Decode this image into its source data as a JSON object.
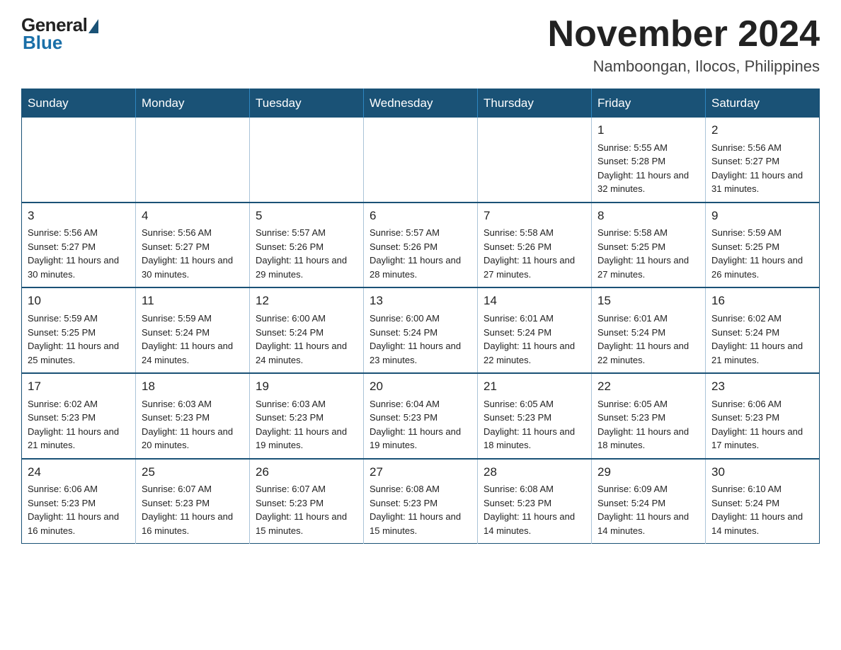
{
  "logo": {
    "general": "General",
    "blue": "Blue"
  },
  "header": {
    "month": "November 2024",
    "location": "Namboongan, Ilocos, Philippines"
  },
  "days_of_week": [
    "Sunday",
    "Monday",
    "Tuesday",
    "Wednesday",
    "Thursday",
    "Friday",
    "Saturday"
  ],
  "weeks": [
    [
      {
        "day": "",
        "info": ""
      },
      {
        "day": "",
        "info": ""
      },
      {
        "day": "",
        "info": ""
      },
      {
        "day": "",
        "info": ""
      },
      {
        "day": "",
        "info": ""
      },
      {
        "day": "1",
        "info": "Sunrise: 5:55 AM\nSunset: 5:28 PM\nDaylight: 11 hours and 32 minutes."
      },
      {
        "day": "2",
        "info": "Sunrise: 5:56 AM\nSunset: 5:27 PM\nDaylight: 11 hours and 31 minutes."
      }
    ],
    [
      {
        "day": "3",
        "info": "Sunrise: 5:56 AM\nSunset: 5:27 PM\nDaylight: 11 hours and 30 minutes."
      },
      {
        "day": "4",
        "info": "Sunrise: 5:56 AM\nSunset: 5:27 PM\nDaylight: 11 hours and 30 minutes."
      },
      {
        "day": "5",
        "info": "Sunrise: 5:57 AM\nSunset: 5:26 PM\nDaylight: 11 hours and 29 minutes."
      },
      {
        "day": "6",
        "info": "Sunrise: 5:57 AM\nSunset: 5:26 PM\nDaylight: 11 hours and 28 minutes."
      },
      {
        "day": "7",
        "info": "Sunrise: 5:58 AM\nSunset: 5:26 PM\nDaylight: 11 hours and 27 minutes."
      },
      {
        "day": "8",
        "info": "Sunrise: 5:58 AM\nSunset: 5:25 PM\nDaylight: 11 hours and 27 minutes."
      },
      {
        "day": "9",
        "info": "Sunrise: 5:59 AM\nSunset: 5:25 PM\nDaylight: 11 hours and 26 minutes."
      }
    ],
    [
      {
        "day": "10",
        "info": "Sunrise: 5:59 AM\nSunset: 5:25 PM\nDaylight: 11 hours and 25 minutes."
      },
      {
        "day": "11",
        "info": "Sunrise: 5:59 AM\nSunset: 5:24 PM\nDaylight: 11 hours and 24 minutes."
      },
      {
        "day": "12",
        "info": "Sunrise: 6:00 AM\nSunset: 5:24 PM\nDaylight: 11 hours and 24 minutes."
      },
      {
        "day": "13",
        "info": "Sunrise: 6:00 AM\nSunset: 5:24 PM\nDaylight: 11 hours and 23 minutes."
      },
      {
        "day": "14",
        "info": "Sunrise: 6:01 AM\nSunset: 5:24 PM\nDaylight: 11 hours and 22 minutes."
      },
      {
        "day": "15",
        "info": "Sunrise: 6:01 AM\nSunset: 5:24 PM\nDaylight: 11 hours and 22 minutes."
      },
      {
        "day": "16",
        "info": "Sunrise: 6:02 AM\nSunset: 5:24 PM\nDaylight: 11 hours and 21 minutes."
      }
    ],
    [
      {
        "day": "17",
        "info": "Sunrise: 6:02 AM\nSunset: 5:23 PM\nDaylight: 11 hours and 21 minutes."
      },
      {
        "day": "18",
        "info": "Sunrise: 6:03 AM\nSunset: 5:23 PM\nDaylight: 11 hours and 20 minutes."
      },
      {
        "day": "19",
        "info": "Sunrise: 6:03 AM\nSunset: 5:23 PM\nDaylight: 11 hours and 19 minutes."
      },
      {
        "day": "20",
        "info": "Sunrise: 6:04 AM\nSunset: 5:23 PM\nDaylight: 11 hours and 19 minutes."
      },
      {
        "day": "21",
        "info": "Sunrise: 6:05 AM\nSunset: 5:23 PM\nDaylight: 11 hours and 18 minutes."
      },
      {
        "day": "22",
        "info": "Sunrise: 6:05 AM\nSunset: 5:23 PM\nDaylight: 11 hours and 18 minutes."
      },
      {
        "day": "23",
        "info": "Sunrise: 6:06 AM\nSunset: 5:23 PM\nDaylight: 11 hours and 17 minutes."
      }
    ],
    [
      {
        "day": "24",
        "info": "Sunrise: 6:06 AM\nSunset: 5:23 PM\nDaylight: 11 hours and 16 minutes."
      },
      {
        "day": "25",
        "info": "Sunrise: 6:07 AM\nSunset: 5:23 PM\nDaylight: 11 hours and 16 minutes."
      },
      {
        "day": "26",
        "info": "Sunrise: 6:07 AM\nSunset: 5:23 PM\nDaylight: 11 hours and 15 minutes."
      },
      {
        "day": "27",
        "info": "Sunrise: 6:08 AM\nSunset: 5:23 PM\nDaylight: 11 hours and 15 minutes."
      },
      {
        "day": "28",
        "info": "Sunrise: 6:08 AM\nSunset: 5:23 PM\nDaylight: 11 hours and 14 minutes."
      },
      {
        "day": "29",
        "info": "Sunrise: 6:09 AM\nSunset: 5:24 PM\nDaylight: 11 hours and 14 minutes."
      },
      {
        "day": "30",
        "info": "Sunrise: 6:10 AM\nSunset: 5:24 PM\nDaylight: 11 hours and 14 minutes."
      }
    ]
  ]
}
